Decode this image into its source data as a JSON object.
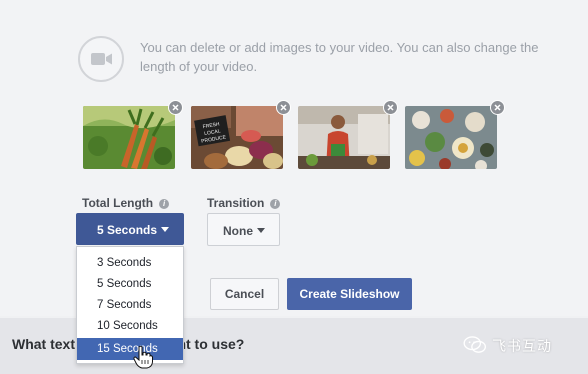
{
  "intro": {
    "icon": "video-camera-icon",
    "text": "You can delete or add images to your video. You can also change the length of your video."
  },
  "thumbnails": [
    {
      "name": "carrots",
      "remove_icon": "close-icon"
    },
    {
      "name": "local-produce",
      "sign_text": "FRESH LOCAL PRODUCE",
      "remove_icon": "close-icon"
    },
    {
      "name": "market-vendor",
      "remove_icon": "close-icon"
    },
    {
      "name": "food-table",
      "remove_icon": "close-icon"
    }
  ],
  "total_length": {
    "label": "Total Length",
    "info_icon": "info-icon",
    "selected": "5 Seconds",
    "options": [
      "3 Seconds",
      "5 Seconds",
      "7 Seconds",
      "10 Seconds",
      "15 Seconds"
    ],
    "highlighted": "15 Seconds"
  },
  "transition": {
    "label": "Transition",
    "info_icon": "info-icon",
    "selected": "None"
  },
  "actions": {
    "cancel": "Cancel",
    "create": "Create Slideshow"
  },
  "question": {
    "before": "What text",
    "after": "you want to use?"
  },
  "watermark": {
    "text": "飞书互动"
  },
  "colors": {
    "primary_blue": "#3f5896",
    "highlight_blue": "#4267b2",
    "panel_bg": "#f2f3f5"
  }
}
